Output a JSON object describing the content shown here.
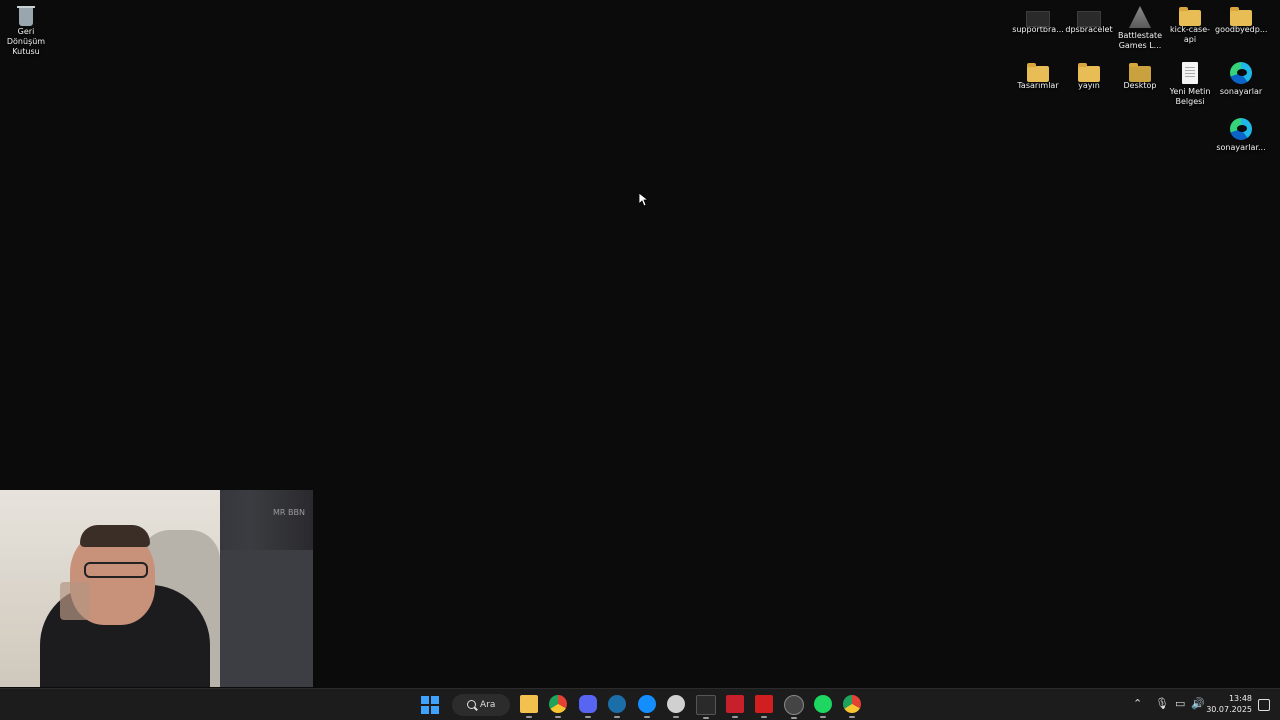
{
  "desktop": {
    "icons": [
      {
        "label": "Geri Dönüşüm Kutusu",
        "icon": "recycle-bin-icon"
      },
      {
        "label": "supportbra...",
        "icon": "shortcut-icon"
      },
      {
        "label": "dpsbracelet",
        "icon": "shortcut-icon"
      },
      {
        "label": "Battlestate Games L...",
        "icon": "battlestate-launcher-icon"
      },
      {
        "label": "kick-case-api",
        "icon": "folder-icon"
      },
      {
        "label": "goodbyedp...",
        "icon": "folder-icon"
      },
      {
        "label": "Tasarımlar",
        "icon": "folder-icon"
      },
      {
        "label": "yayın",
        "icon": "folder-icon"
      },
      {
        "label": "Desktop",
        "icon": "folder-icon"
      },
      {
        "label": "Yeni Metin Belgesi",
        "icon": "text-document-icon"
      },
      {
        "label": "sonayarlar",
        "icon": "edge-icon"
      },
      {
        "label": "sonayarlar...",
        "icon": "edge-icon"
      }
    ]
  },
  "webcam": {
    "wall_text": "MR BBN"
  },
  "taskbar": {
    "search_label": "Ara",
    "pinned": [
      {
        "name": "file-explorer-icon",
        "color": "#f2c14e"
      },
      {
        "name": "chrome-icon",
        "color": "#e34133"
      },
      {
        "name": "discord-icon",
        "color": "#5865f2"
      },
      {
        "name": "steam-icon",
        "color": "#1b6ea8"
      },
      {
        "name": "battle-net-icon",
        "color": "#148eff"
      },
      {
        "name": "obs-icon",
        "color": "#d0d0d0"
      },
      {
        "name": "epic-games-icon",
        "color": "#2a2a2a"
      },
      {
        "name": "app-red-icon",
        "color": "#c8202a"
      },
      {
        "name": "app-red2-icon",
        "color": "#d11f1f"
      },
      {
        "name": "app-circle-icon",
        "color": "#888888"
      },
      {
        "name": "spotify-icon",
        "color": "#1ed760"
      },
      {
        "name": "chrome-alt-icon",
        "color": "#e34133"
      }
    ],
    "time": "13:48",
    "date": "30.07.2025"
  }
}
